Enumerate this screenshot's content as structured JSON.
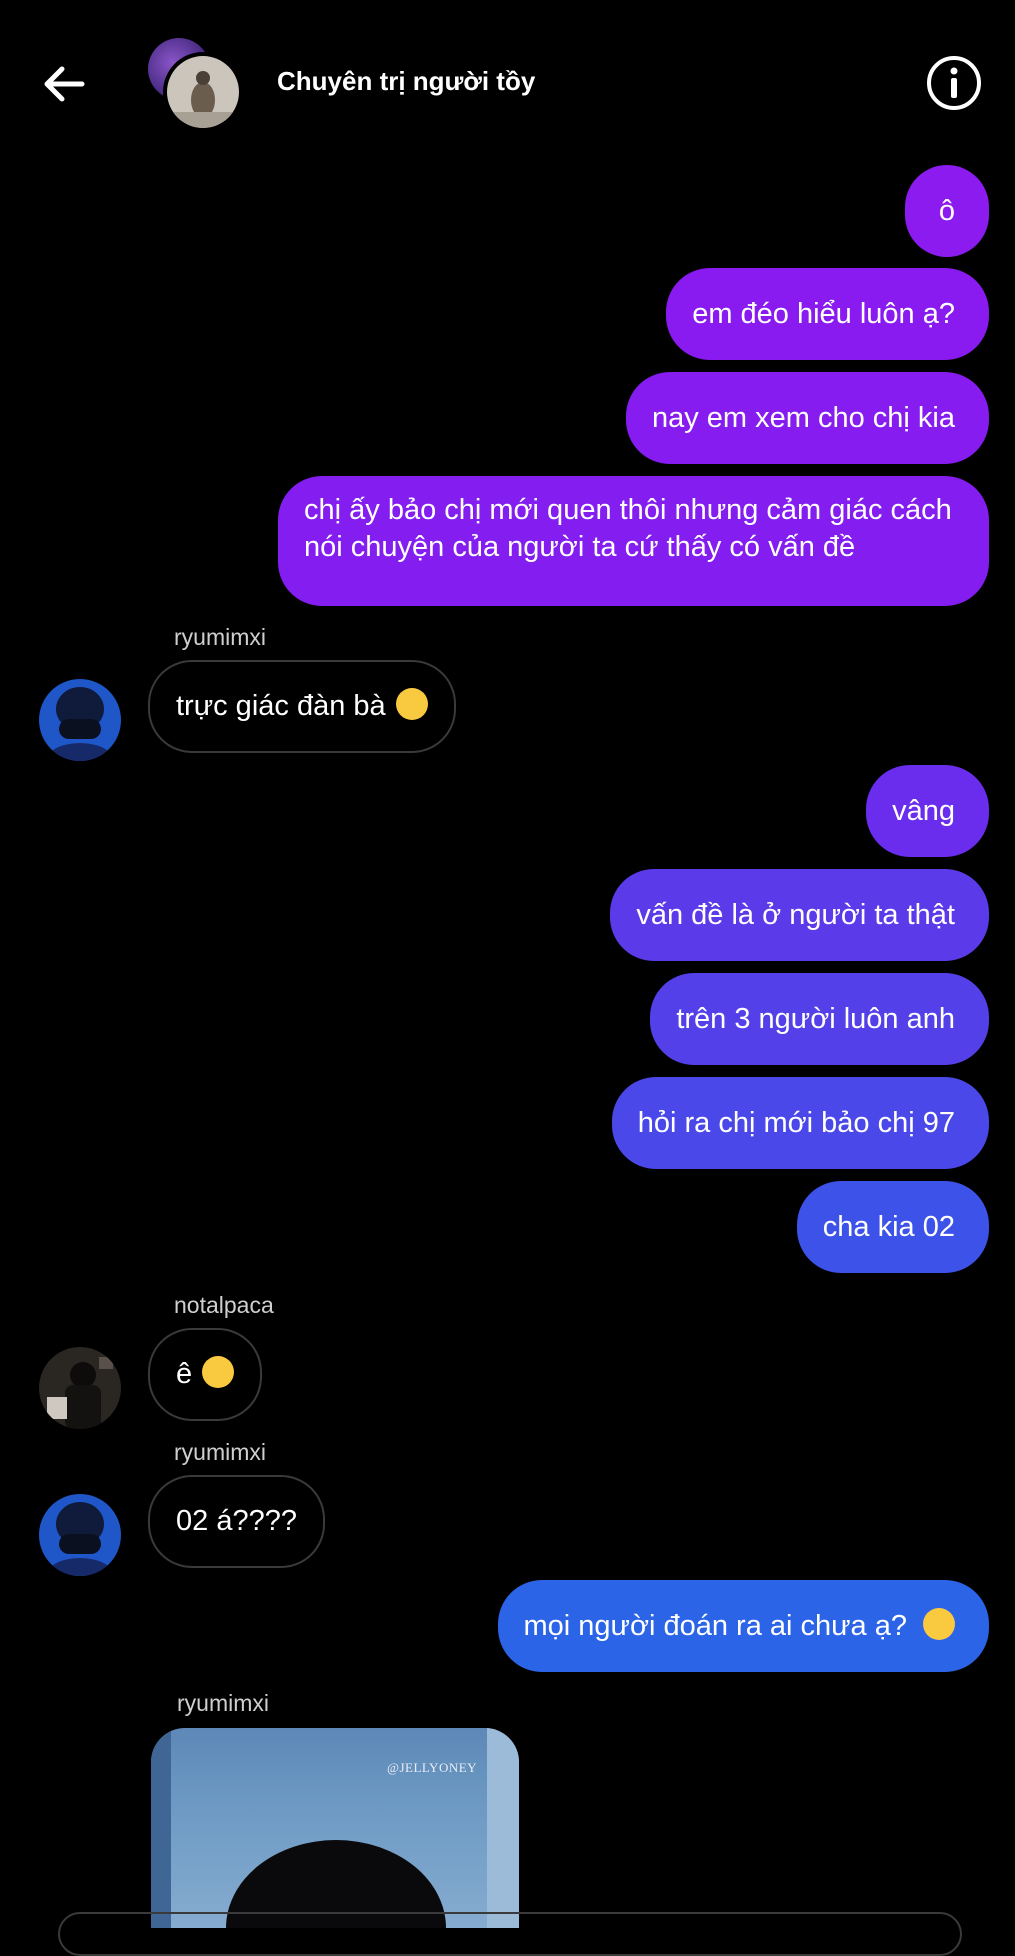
{
  "header": {
    "title": "Chuyên trị người tồy"
  },
  "messages": [
    {
      "text": "ô"
    },
    {
      "text": "em đéo hiểu luôn ạ?"
    },
    {
      "text": "nay em xem cho chị kia"
    },
    {
      "text": "chị ấy bảo chị mới quen thôi nhưng cảm giác cách nói chuyện của người ta cứ thấy có vấn đề"
    },
    {
      "sender": "ryumimxi",
      "text": "trực giác đàn bà",
      "emoji": "sneezing-face"
    },
    {
      "text": "vâng"
    },
    {
      "text": "vấn đề là ở người ta thật"
    },
    {
      "text": "trên 3 người luôn anh"
    },
    {
      "text": "hỏi ra chị mới bảo chị 97"
    },
    {
      "text": "cha kia 02"
    },
    {
      "sender": "notalpaca",
      "text": "ê",
      "emoji": "tired-face"
    },
    {
      "sender": "ryumimxi",
      "text": "02 á????"
    },
    {
      "text": "mọi người đoán ra ai chưa ạ?",
      "emoji": "kissing-face-closed-eyes"
    },
    {
      "sender": "ryumimxi",
      "image_watermark": "@JELLYONEY"
    }
  ],
  "colors": {
    "bubble_purple": "#8c1bf0",
    "bubble_violet": "#5a3ce6",
    "bubble_blue": "#2c64e8",
    "incoming_border": "#3a3a3c"
  }
}
